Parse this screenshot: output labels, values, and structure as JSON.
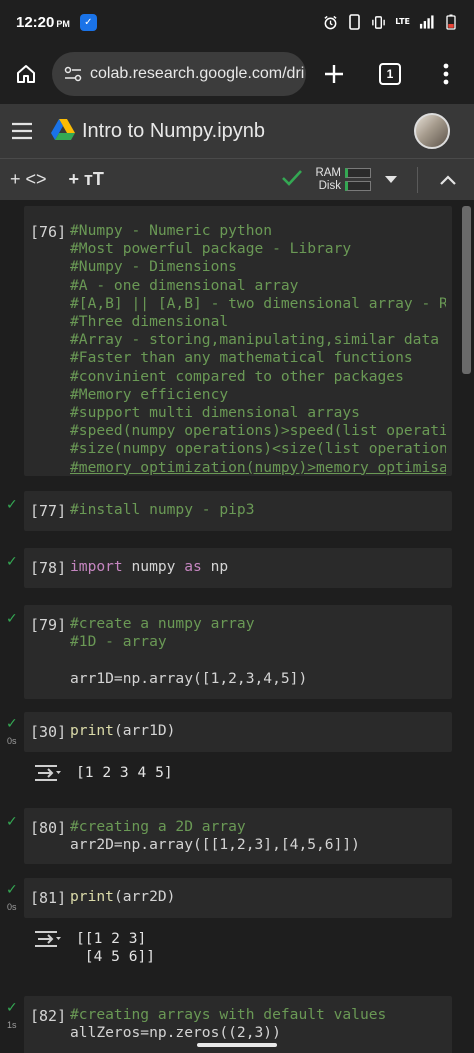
{
  "status": {
    "time": "12:20",
    "ampm": "PM",
    "network": "LTE"
  },
  "browser": {
    "url": "colab.research.google.com/dri",
    "tab_count": "1"
  },
  "colab": {
    "title": "Intro to Numpy.ipynb"
  },
  "toolbar": {
    "add_code": "+ <>",
    "add_text": "+ ᴛT",
    "ram_label": "RAM",
    "disk_label": "Disk",
    "accent": "#34a853"
  },
  "cells": [
    {
      "number": "[76]",
      "lines": [
        "#Numpy - Numeric python",
        "#Most powerful package - Library",
        "#Numpy - Dimensions",
        "#A - one dimensional array",
        "#[A,B] || [A,B] - two dimensional array - R",
        "#Three dimensional",
        "#Array - storing,manipulating,similar data",
        "#Faster than any mathematical functions",
        "#convinient compared to other packages",
        "#Memory efficiency",
        "#support multi dimensional arrays",
        "#speed(numpy operations)>speed(list operati",
        "#size(numpy operations)<size(list operation",
        "#memory optimization(numpy)>memory optimisa"
      ]
    },
    {
      "number": "[77]",
      "code": "#install numpy - pip3"
    },
    {
      "number": "[78]",
      "kw1": "import",
      "mid": " numpy ",
      "kw2": "as",
      "tail": " np"
    },
    {
      "number": "[79]",
      "line1": "#create a numpy array",
      "line2": "#1D - array",
      "line3": "arr1D=np.array([1,2,3,4,5])"
    },
    {
      "number": "[30]",
      "fn": "print",
      "args": "(arr1D)",
      "time": "0s",
      "output": "[1 2 3 4 5]"
    },
    {
      "number": "[80]",
      "line1": "#creating a 2D array",
      "line2": "arr2D=np.array([[1,2,3],[4,5,6]])"
    },
    {
      "number": "[81]",
      "fn": "print",
      "args": "(arr2D)",
      "time": "0s",
      "output": "[[1 2 3]\n [4 5 6]]"
    },
    {
      "number": "[82]",
      "time": "1s",
      "line1": "#creating arrays with default values",
      "line2": "allZeros=np.zeros((2,3))"
    }
  ]
}
